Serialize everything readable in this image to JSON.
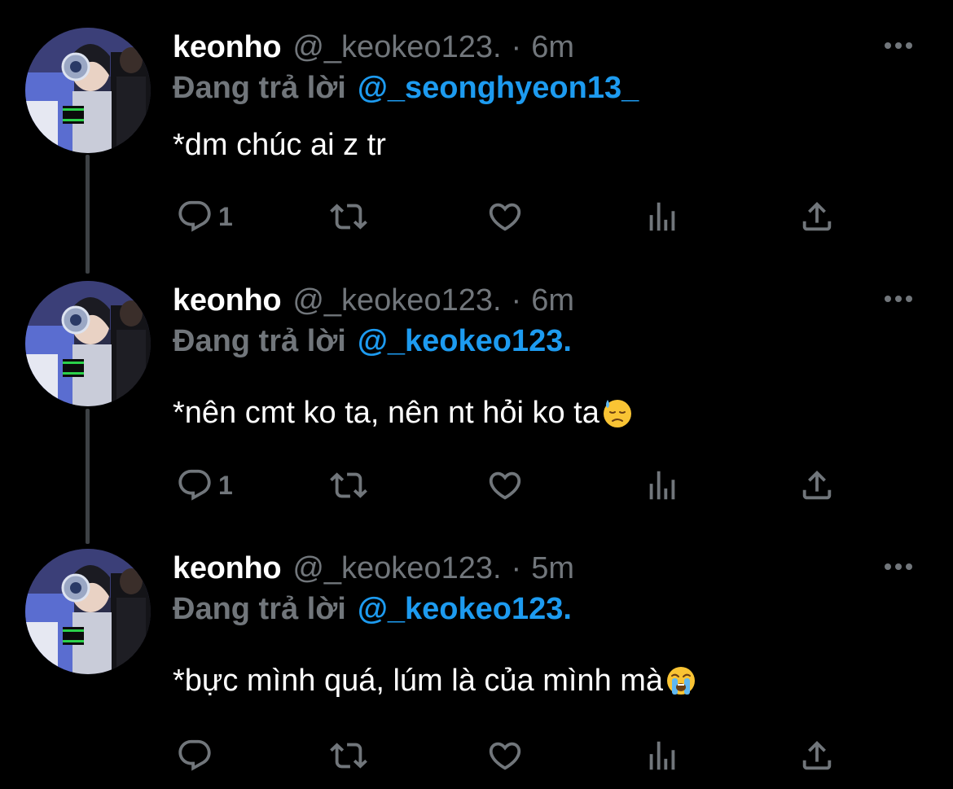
{
  "colors": {
    "background": "#000000",
    "name": "#ffffff",
    "muted": "#71767b",
    "link": "#1d9bf0",
    "thread_line": "#3d4145"
  },
  "tweets": [
    {
      "name": "keonho",
      "handle": "@_keokeo123.",
      "dot": "·",
      "time": "6m",
      "reply_prefix": "Đang trả lời",
      "reply_handle": "@_seonghyeon13_",
      "text": "*dm chúc ai z tr",
      "emoji": "",
      "reply_count": "1",
      "icons": [
        "reply-icon",
        "retweet-icon",
        "like-icon",
        "views-icon",
        "share-icon",
        "more-icon"
      ]
    },
    {
      "name": "keonho",
      "handle": "@_keokeo123.",
      "dot": "·",
      "time": "6m",
      "reply_prefix": "Đang trả lời",
      "reply_handle": "@_keokeo123.",
      "text": "*nên cmt ko ta, nên nt hỏi ko ta",
      "emoji": "downcast-face-with-sweat-emoji",
      "reply_count": "1",
      "icons": [
        "reply-icon",
        "retweet-icon",
        "like-icon",
        "views-icon",
        "share-icon",
        "more-icon"
      ]
    },
    {
      "name": "keonho",
      "handle": "@_keokeo123.",
      "dot": "·",
      "time": "5m",
      "reply_prefix": "Đang trả lời",
      "reply_handle": "@_keokeo123.",
      "text": "*bực mình quá, lúm là của mình mà",
      "emoji": "loudly-crying-face-emoji",
      "reply_count": "",
      "icons": [
        "reply-icon",
        "retweet-icon",
        "like-icon",
        "views-icon",
        "share-icon",
        "more-icon"
      ]
    }
  ]
}
